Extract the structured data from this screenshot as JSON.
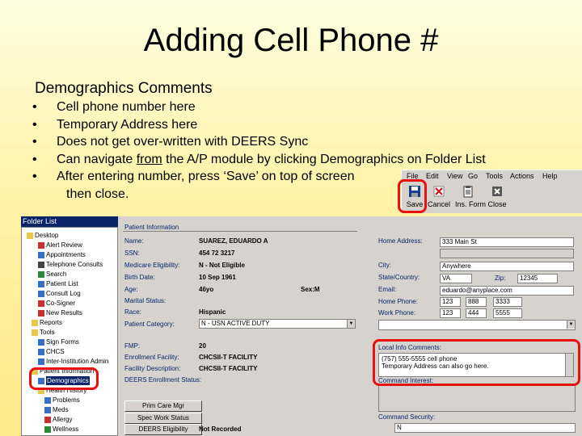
{
  "slide": {
    "title": "Adding Cell Phone #",
    "heading": "Demographics Comments",
    "bullets": [
      {
        "marker": "•",
        "text": "Cell phone number here"
      },
      {
        "marker": "•",
        "text": "Temporary Address here"
      },
      {
        "marker": "•",
        "text": "Does not get over-written with DEERS Sync"
      },
      {
        "marker": "•",
        "pre": "Can navigate ",
        "underline": "from",
        "post": " the A/P module by clicking Demographics on Folder List"
      },
      {
        "marker": "•",
        "text": "After entering number, press ‘Save’ on top of screen"
      }
    ],
    "bullet_continuation": "then close."
  },
  "toolbar": {
    "menus": [
      "File",
      "Edit",
      "View",
      "Go",
      "Tools",
      "Actions",
      "Help"
    ],
    "buttons": [
      {
        "label": "Save",
        "icon": "save-disk-icon"
      },
      {
        "label": "Cancel",
        "icon": "cancel-x-icon"
      },
      {
        "label": "Ins. Form",
        "icon": "insert-form-icon"
      },
      {
        "label": "Close",
        "icon": "close-icon"
      }
    ]
  },
  "folder_list": {
    "title": "Folder List",
    "items": [
      "Desktop",
      "Alert Review",
      "Appointments",
      "Telephone Consults",
      "Search",
      "Patient List",
      "Consult Log",
      "Co-Signer",
      "New Results",
      "Reports",
      "Tools",
      "Sign Forms",
      "CHCS",
      "Inter-Institution Admin",
      "Patient Information",
      "Demographics",
      "Health History",
      "Problems",
      "Meds",
      "Allergy",
      "Wellness"
    ],
    "selected": "Demographics"
  },
  "patient": {
    "section_title": "Patient Information",
    "name_label": "Name:",
    "name": "SUAREZ, EDUARDO A",
    "ssn_label": "SSN:",
    "ssn": "454 72 3217",
    "medicare_label": "Medicare Eligibility:",
    "medicare": "N - Not Eligible",
    "dob_label": "Birth Date:",
    "dob": "10 Sep 1961",
    "age_label": "Age:",
    "age": "46yo",
    "sex": "Sex:M",
    "marital_label": "Marital Status:",
    "marital": "",
    "race_label": "Race:",
    "race": "Hispanic",
    "patient_cat_label": "Patient Category:",
    "patient_cat": "N - USN ACTIVE DUTY",
    "fmp_label": "FMP:",
    "fmp": "20",
    "enroll_label": "Enrollment Facility:",
    "enroll": "CHCSII-T FACILITY",
    "facility_label": "Facility Description:",
    "facility": "CHCSII-T FACILITY",
    "deers_label": "DEERS Enrollment Status:",
    "deers": "",
    "home_address_label": "Home Address:",
    "home_address": "333 Main St",
    "city_label": "City:",
    "city": "Anywhere",
    "state_label": "State/Country:",
    "state": "VA",
    "zip_label": "Zip:",
    "zip": "12345",
    "email_label": "Email:",
    "email": "eduardo@anyplace.com",
    "home_phone_label": "Home Phone:",
    "home_phone": [
      "123",
      "888",
      "3333"
    ],
    "work_phone_label": "Work Phone:",
    "work_phone": [
      "123",
      "444",
      "5555"
    ],
    "comments_label": "Local Info Comments:",
    "comments_lines": [
      "(757) 555-5555 cell phone",
      "Temporary Address can also go here."
    ],
    "command_interest_label": "Command Interest:",
    "command_security_label": "Command Security:",
    "command_security": "N",
    "primary_care_btn": "Prim Care Mgr",
    "special_work_btn": "Spec Work Status",
    "deers_elig_btn": "DEERS Eligibility",
    "deers_elig_value": "Not Recorded"
  }
}
